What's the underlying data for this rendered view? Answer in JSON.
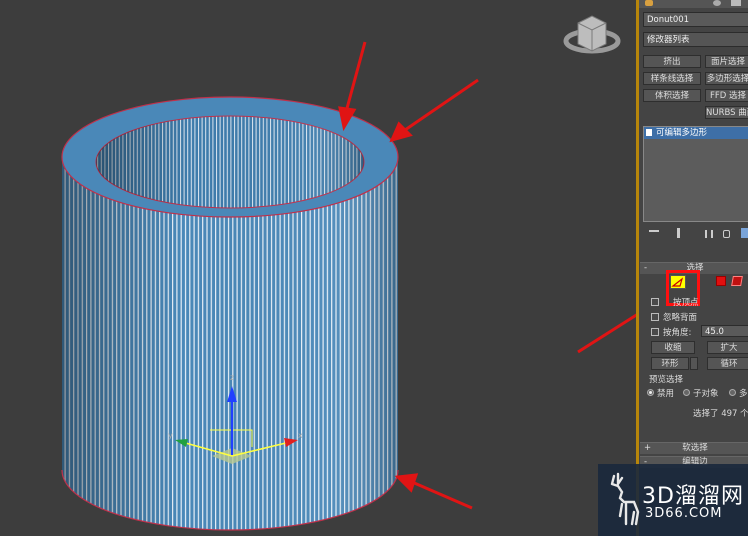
{
  "panel": {
    "object_name": "Donut001",
    "modifier_list": "修改器列表",
    "buttons": {
      "extrude": "挤出",
      "face_select": "面片选择",
      "spline_select": "样条线选择",
      "poly_select": "多边形选择",
      "volume_select": "体积选择",
      "ffd_select": "FFD 选择",
      "nurbs": "NURBS 曲面"
    },
    "stack_item": "可编辑多边形"
  },
  "selection": {
    "title": "选择",
    "by_vertex": "按顶点",
    "ignore_backfacing": "忽略背面",
    "by_angle": "按角度:",
    "angle_value": "45.0",
    "shrink": "收缩",
    "grow": "扩大",
    "ring": "环形",
    "loop": "循环",
    "preview_title": "预览选择",
    "preview_off": "禁用",
    "preview_subobj": "子对象",
    "preview_multi": "多",
    "status": "选择了 497 个",
    "soft_selection": "软选择",
    "edit_edges": "编辑边",
    "sign_minus": "-",
    "sign_plus": "+"
  },
  "gizmo": {
    "z": "z",
    "x": "x",
    "y": "y"
  },
  "watermark": {
    "text": "3D溜溜网",
    "url": "3D66.COM"
  },
  "colors": {
    "cylinder": "#4a88b8",
    "arrow": "#e01414",
    "highlight": "#ffff00"
  }
}
